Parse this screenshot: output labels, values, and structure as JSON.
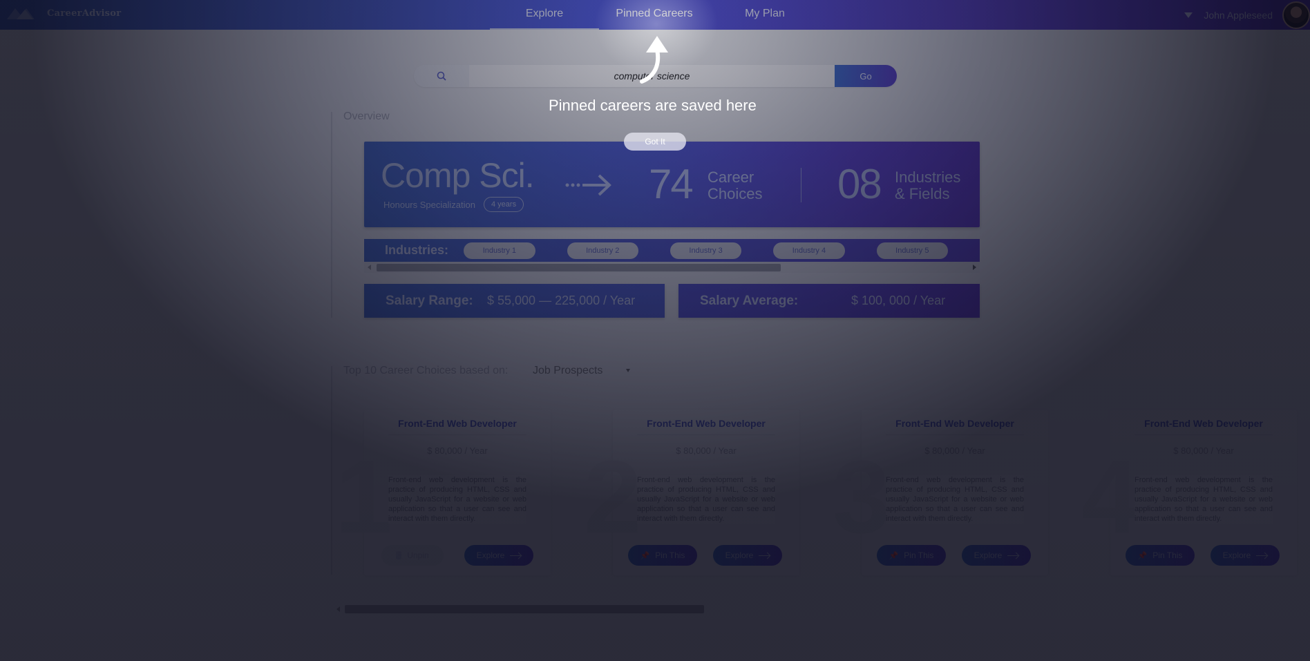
{
  "app": {
    "name": "CareerAdvisor"
  },
  "nav": {
    "tabs": [
      {
        "label": "Explore"
      },
      {
        "label": "Pinned Careers"
      },
      {
        "label": "My Plan"
      }
    ],
    "user_name": "John Appleseed"
  },
  "search": {
    "value": "computer science",
    "go_label": "Go"
  },
  "overview": {
    "label": "Overview",
    "program": "Comp Sci.",
    "specialization": "Honours Specialization",
    "duration": "4 years",
    "career_count": "74",
    "career_label_1": "Career",
    "career_label_2": "Choices",
    "industry_count": "08",
    "industry_label_1": "Industries",
    "industry_label_2": "& Fields",
    "industries_title": "Industries:",
    "industries": [
      "Industry 1",
      "Industry 2",
      "Industry 3",
      "Industry 4",
      "Industry 5"
    ],
    "salary_range_label": "Salary Range:",
    "salary_range_value": "$ 55,000  —  225,000 / Year",
    "salary_avg_label": "Salary Average:",
    "salary_avg_value": "$ 100, 000 / Year"
  },
  "top10": {
    "label": "Top 10 Career Choices based on:",
    "sort_value": "Job Prospects",
    "cards": [
      {
        "rank": "1",
        "title": "Front-End Web Developer",
        "salary": "$ 80,000  /  Year",
        "description": "Front-end web development is the practice of producing HTML, CSS and usually JavaScript for a website or web application so that a user can see and interact with them directly.",
        "pin_label": "Unpin",
        "explore_label": "Explore"
      },
      {
        "rank": "2",
        "title": "Front-End Web Developer",
        "salary": "$ 80,000  /  Year",
        "description": "Front-end web development is the practice of producing HTML, CSS and usually JavaScript for a website or web application so that a user can see and interact with them directly.",
        "pin_label": "Pin This",
        "explore_label": "Explore"
      },
      {
        "rank": "3",
        "title": "Front-End Web Developer",
        "salary": "$ 80,000  /  Year",
        "description": "Front-end web development is the practice of producing HTML, CSS and usually JavaScript for a website or web application so that a user can see and interact with them directly.",
        "pin_label": "Pin This",
        "explore_label": "Explore"
      },
      {
        "rank": "4",
        "title": "Front-End Web Developer",
        "salary": "$ 80,000  /  Year",
        "description": "Front-end web development is the practice of producing HTML, CSS and usually JavaScript for a website or web application so that a user can see and interact with them directly.",
        "pin_label": "Pin This",
        "explore_label": "Explore"
      }
    ]
  },
  "coachmark": {
    "message": "Pinned careers are saved here",
    "button": "Got It"
  },
  "colors": {
    "accent_start": "#3e6fd0",
    "accent_end": "#5a3fcf"
  },
  "icons": [
    "logo-icon",
    "search-icon",
    "chevron-down-icon",
    "pin-icon",
    "arrow-right-icon",
    "coach-arrow-icon"
  ]
}
